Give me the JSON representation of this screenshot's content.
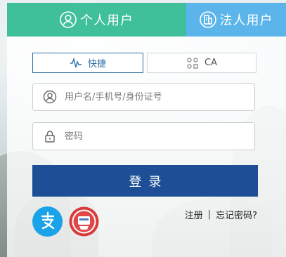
{
  "tabs": {
    "personal": {
      "label": "个人用户",
      "icon": "user-icon"
    },
    "legal": {
      "label": "法人用户",
      "icon": "building-icon"
    }
  },
  "login_modes": {
    "fast": {
      "label": "快捷",
      "icon": "pulse-icon"
    },
    "ca": {
      "label": "CA",
      "icon": "ca-dots-icon"
    }
  },
  "form": {
    "username_placeholder": "用户名/手机号/身份证号",
    "password_placeholder": "密码",
    "submit_label": "登录"
  },
  "footer": {
    "register": "注册",
    "separator": "|",
    "forgot_password": "忘记密码?"
  },
  "third_party": [
    {
      "name": "alipay",
      "icon": "alipay-icon",
      "color": "#1aa3e8"
    },
    {
      "name": "social-security",
      "icon": "social-security-icon",
      "color": "#d93a3a"
    }
  ],
  "colors": {
    "personal_tab": "#3fbf9a",
    "legal_tab": "#5cb5ea",
    "primary": "#1e4f96",
    "fast_border": "#2b6fa8"
  }
}
